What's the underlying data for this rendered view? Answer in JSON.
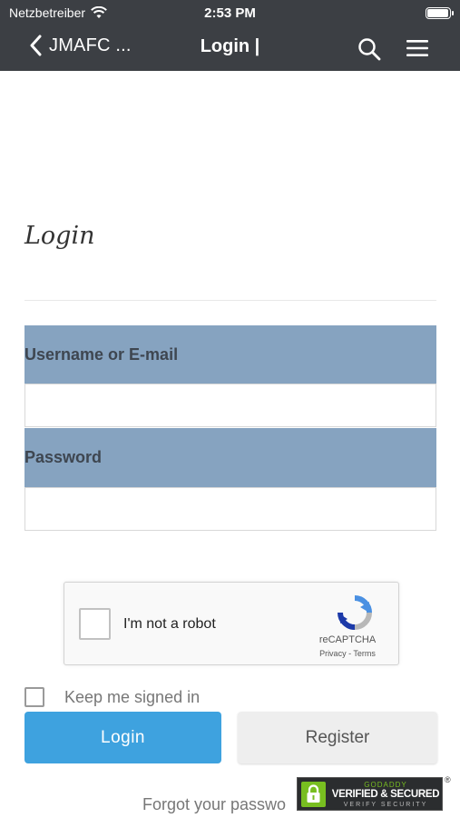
{
  "status_bar": {
    "carrier": "Netzbetreiber",
    "time": "2:53 PM",
    "icons": [
      "wifi-icon",
      "battery-icon"
    ]
  },
  "nav": {
    "back_label": "JMAFC ...",
    "title": "Login |",
    "icons": [
      "chevron-left-icon",
      "search-icon",
      "hamburger-menu-icon"
    ]
  },
  "page": {
    "heading": "Login"
  },
  "form": {
    "username_label": "Username or E-mail",
    "username_value": "",
    "password_label": "Password",
    "password_value": "",
    "label_bg_color": "#86a3c0"
  },
  "captcha": {
    "text": "I'm not a robot",
    "brand": "reCAPTCHA",
    "privacy": "Privacy",
    "separator": " - ",
    "terms": "Terms",
    "checked": false
  },
  "keep_signed_in": {
    "label": "Keep me signed in",
    "checked": false
  },
  "buttons": {
    "login": "Login",
    "register": "Register",
    "login_color": "#3ea2df"
  },
  "forgot_link": "Forgot your passwo",
  "badge": {
    "top": "GODADDY",
    "main": "VERIFIED & SECURED",
    "sub": "VERIFY SECURITY",
    "registered": "®"
  }
}
